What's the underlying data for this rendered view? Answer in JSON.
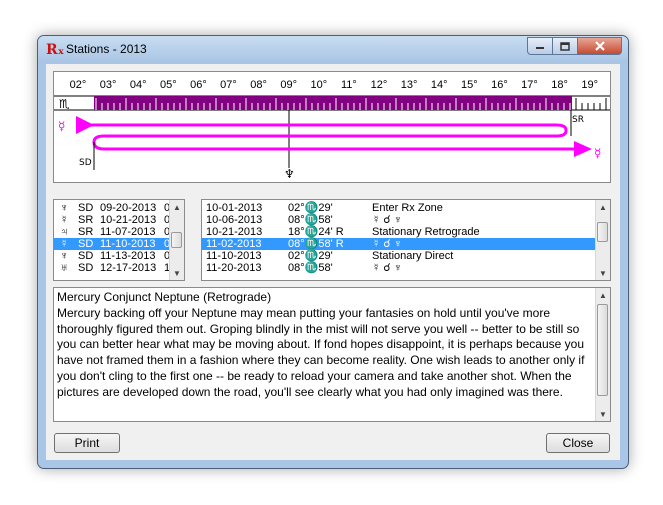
{
  "window": {
    "title": "Stations - 2013",
    "app_icon": "Rₓ"
  },
  "chart": {
    "degree_labels": [
      "02°",
      "03°",
      "04°",
      "05°",
      "06°",
      "07°",
      "08°",
      "09°",
      "10°",
      "11°",
      "12°",
      "13°",
      "14°",
      "15°",
      "16°",
      "17°",
      "18°",
      "19°"
    ],
    "sign_glyph": "♏",
    "planet_glyph_top": "☿",
    "planet_glyph_bottom": "☿",
    "label_sr": "SR",
    "label_sd": "SD",
    "neptune_glyph": "♆",
    "colors": {
      "zone": "#800080",
      "path": "#ff00ff"
    }
  },
  "left_list": {
    "rows": [
      {
        "glyph": "♆",
        "code": "SD",
        "date": "09-20-2013",
        "extra": "0"
      },
      {
        "glyph": "☿",
        "code": "SR",
        "date": "10-21-2013",
        "extra": "0"
      },
      {
        "glyph": "♃",
        "code": "SR",
        "date": "11-07-2013",
        "extra": "0"
      },
      {
        "glyph": "☿",
        "code": "SD",
        "date": "11-10-2013",
        "extra": "0"
      },
      {
        "glyph": "♆",
        "code": "SD",
        "date": "11-13-2013",
        "extra": "0"
      },
      {
        "glyph": "♅",
        "code": "SD",
        "date": "12-17-2013",
        "extra": "1"
      }
    ]
  },
  "right_list": {
    "rows": [
      {
        "date": "10-01-2013",
        "position": "02°♏29'",
        "event": "Enter  Rx  Zone"
      },
      {
        "date": "10-06-2013",
        "position": "08°♏58'",
        "event": "☿  ☌  ♆"
      },
      {
        "date": "10-21-2013",
        "position": "18°♏24' R",
        "event": "Stationary  Retrograde"
      },
      {
        "date": "11-02-2013",
        "position": "08°♏58' R",
        "event": "☿  ☌  ♆"
      },
      {
        "date": "11-10-2013",
        "position": "02°♏29'",
        "event": "Stationary  Direct"
      },
      {
        "date": "11-20-2013",
        "position": "08°♏58'",
        "event": "☿  ☌  ♆"
      }
    ]
  },
  "interpretation": {
    "heading": "Mercury Conjunct Neptune (Retrograde)",
    "body": "Mercury backing off your Neptune may mean putting your fantasies on hold until you've more thoroughly figured them out. Groping blindly in the mist will not serve you well -- better to be still so you can better hear what may be moving about. If fond hopes disappoint, it is perhaps because you have not framed them in a fashion where they can become reality. One wish leads to another only if you don't cling to the first one -- be ready to reload your camera and take another shot. When the pictures are developed down the road, you'll see clearly what you had only imagined was there."
  },
  "buttons": {
    "print": "Print",
    "close": "Close"
  }
}
